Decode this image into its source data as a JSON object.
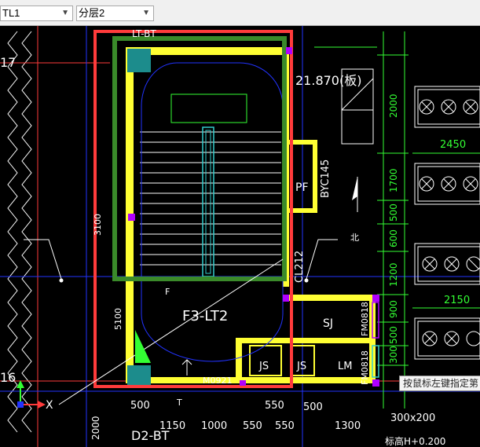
{
  "toolbar": {
    "layer_select_value": "TL1",
    "floor_select_value": "分层2",
    "dropdown_icon": "chevron-down-icon"
  },
  "drawing": {
    "top_partial_label": "LT-BT",
    "elevation_label": "21.870(板)",
    "component_label": "F3-LT2",
    "pf_label": "PF",
    "byc_label": "BYC145",
    "pipe_label": "CL212",
    "sj_label": "SJ",
    "fm1_label": "FM0818",
    "fm2_label": "FM0818",
    "js1_label": "JS",
    "js2_label": "JS",
    "lm_label": "LM",
    "door_label": "M0921",
    "f_label": "F",
    "t_label": "T",
    "d2bt_label": "D2-BT",
    "axis_17": "17",
    "axis_16": "16",
    "axis_x": "X",
    "dim_2450": "2450",
    "dim_2150": "2150",
    "dim_2000": "2000",
    "dim_1700": "1700",
    "dim_500a": "500",
    "dim_600": "600",
    "dim_1200": "1200",
    "dim_900": "900",
    "dim_500b": "500",
    "dim_300a": "300",
    "dim_3100": "3100",
    "dim_vert_5100": "5100",
    "dim_b_500": "500",
    "dim_b_1150": "1150",
    "dim_b_1000": "1000",
    "dim_b_550a": "550",
    "dim_b_550b": "550",
    "dim_b_1300": "1300",
    "dim_b_2000": "2000",
    "dim_b_550c": "550",
    "dim_b_500c": "500",
    "beam_label": "300x200",
    "level_label": "标高H+0.200",
    "north_label": "北"
  },
  "tooltip": "按鼠标左键指定第",
  "colors": {
    "background": "#000000",
    "wall": "#ffff33",
    "selection_red": "#ff3b3b",
    "selection_green": "#3a8a2a",
    "dimension": "#33ff33",
    "stair": "#ffffff",
    "blue": "#2233ff",
    "cyan": "#33cccc",
    "magenta": "#b000ff"
  }
}
